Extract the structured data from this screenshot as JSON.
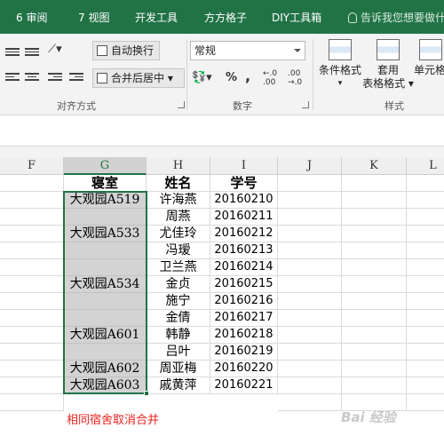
{
  "ribbon_tabs": [
    "6 审阅",
    "7 视图",
    "开发工具",
    "方方格子",
    "DIY工具箱"
  ],
  "tell_me": "告诉我您想要做什",
  "ribbon": {
    "wrap_text": "自动换行",
    "merge_center": "合并后居中",
    "alignment_group": "对齐方式",
    "number_format": "常规",
    "percent_symbol": "%",
    "comma_symbol": ",",
    "increase_decimal": "←.0 .00",
    "decrease_decimal": ".00 →.0",
    "number_group": "数字",
    "conditional_format": "条件格式",
    "format_as_table_1": "套用",
    "format_as_table_2": "表格格式",
    "cell_styles": "单元格",
    "styles_group": "样式"
  },
  "columns": [
    "F",
    "G",
    "H",
    "I",
    "J",
    "K",
    "L"
  ],
  "table_header": {
    "room": "寝室",
    "name": "姓名",
    "id": "学号"
  },
  "rooms": [
    {
      "label": "大观园A519",
      "rows": 1
    },
    {
      "label": "大观园A533",
      "rows": 3
    },
    {
      "label": "大观园A534",
      "rows": 3
    },
    {
      "label": "大观园A601",
      "rows": 3
    },
    {
      "label": "大观园A602",
      "rows": 1
    },
    {
      "label": "大观园A603",
      "rows": 1
    }
  ],
  "students": [
    {
      "name": "许海燕",
      "id": "20160210"
    },
    {
      "name": "周燕",
      "id": "20160211"
    },
    {
      "name": "尤佳玲",
      "id": "20160212"
    },
    {
      "name": "冯瑷",
      "id": "20160213"
    },
    {
      "name": "卫兰燕",
      "id": "20160214"
    },
    {
      "name": "金贞",
      "id": "20160215"
    },
    {
      "name": "施宁",
      "id": "20160216"
    },
    {
      "name": "金倩",
      "id": "20160217"
    },
    {
      "name": "韩静",
      "id": "20160218"
    },
    {
      "name": "吕叶",
      "id": "20160219"
    },
    {
      "name": "周亚梅",
      "id": "20160220"
    },
    {
      "name": "戚黄萍",
      "id": "20160221"
    }
  ],
  "note": "相同宿舍取消合并",
  "watermark": "Bai 经验",
  "colors": {
    "accent": "#217346",
    "note": "#e8231f",
    "selection_fill": "#d3d3d3"
  }
}
